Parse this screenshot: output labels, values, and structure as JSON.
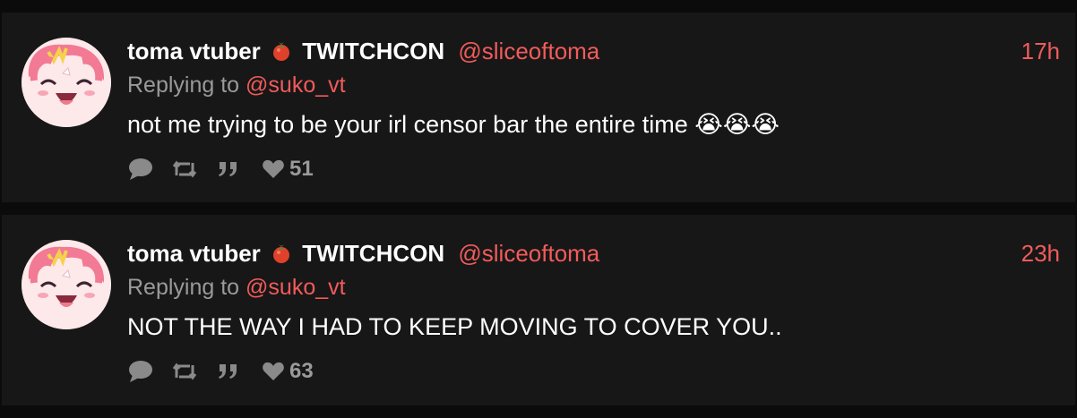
{
  "colors": {
    "accent": "#f25b5b",
    "card": "#171717",
    "page": "#0b0b0b",
    "muted": "#9a9a9a"
  },
  "tweets": [
    {
      "author_name": "toma vtuber",
      "author_badge": "TWITCHCON",
      "handle": "@sliceoftoma",
      "time": "17h",
      "replying_prefix": "Replying to",
      "replying_to": "@suko_vt",
      "text": "not me trying to be your irl censor bar the entire time 😭😭😭",
      "likes": "51"
    },
    {
      "author_name": "toma vtuber",
      "author_badge": "TWITCHCON",
      "handle": "@sliceoftoma",
      "time": "23h",
      "replying_prefix": "Replying to",
      "replying_to": "@suko_vt",
      "text": "NOT THE WAY I HAD TO KEEP MOVING TO COVER YOU..",
      "likes": "63"
    }
  ],
  "icons": [
    "tomato-icon",
    "comment-icon",
    "retweet-icon",
    "quote-icon",
    "heart-icon"
  ]
}
